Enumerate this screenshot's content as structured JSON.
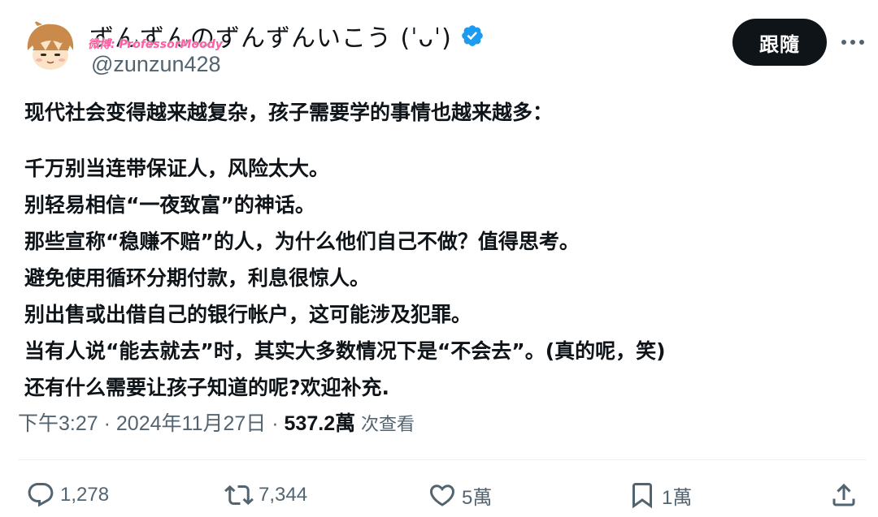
{
  "author": {
    "display_name": "ずんずんのずんずんいこう (ˈᴗˈ)",
    "handle": "@zunzun428",
    "watermark": "微博: ProfessorMoody"
  },
  "header": {
    "follow_label": "跟隨"
  },
  "tweet": {
    "lines": [
      "现代社会变得越来越复杂，孩子需要学的事情也越来越多：",
      "千万别当连带保证人，风险太大。",
      "别轻易相信“一夜致富”的神话。",
      "那些宣称“稳赚不赔”的人，为什么他们自己不做？值得思考。",
      "避免使用循环分期付款，利息很惊人。",
      "别出售或出借自己的银行帐户，这可能涉及犯罪。",
      "当有人说“能去就去”时，其实大多数情况下是“不会去”。(真的呢，笑)",
      "还有什么需要让孩子知道的呢?欢迎补充."
    ]
  },
  "meta": {
    "time": "下午3:27",
    "date": "2024年11月27日",
    "separator": "·",
    "views_count": "537.2萬",
    "views_label": "次查看"
  },
  "actions": {
    "replies": "1,278",
    "reposts": "7,344",
    "likes": "5萬",
    "bookmarks": "1萬"
  },
  "colors": {
    "text": "#0f1419",
    "secondary": "#536471",
    "verified": "#1d9bf0",
    "follow_bg": "#0f1419"
  },
  "icons": [
    "avatar-image",
    "verified-badge-icon",
    "more-icon",
    "reply-icon",
    "repost-icon",
    "like-icon",
    "bookmark-icon",
    "share-icon"
  ]
}
